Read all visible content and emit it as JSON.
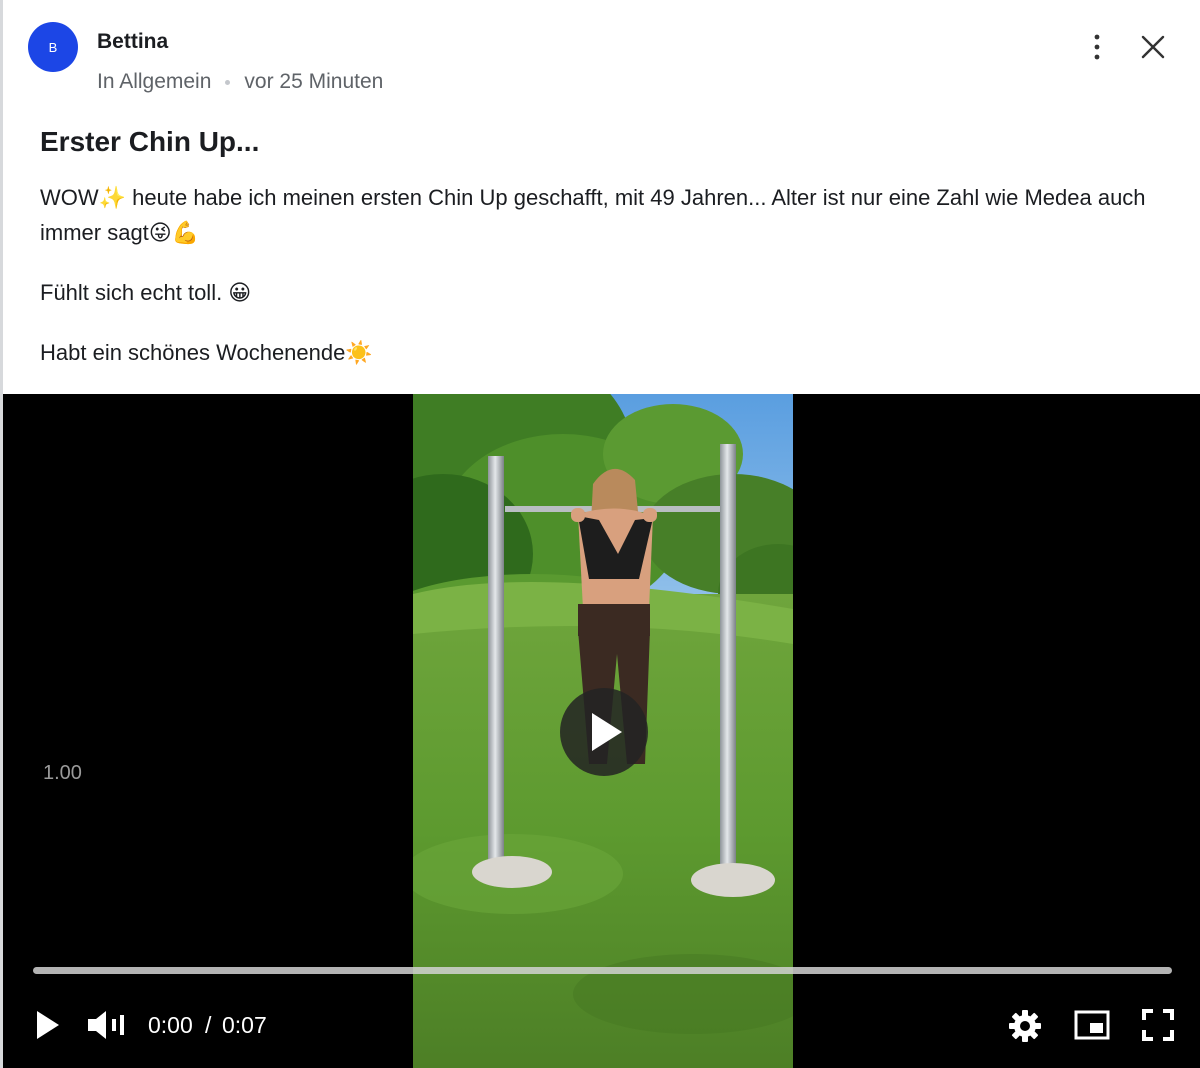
{
  "post": {
    "avatar_initial": "B",
    "author": "Bettina",
    "category": "In Allgemein",
    "time_ago": "vor 25 Minuten",
    "title": "Erster Chin Up...",
    "paragraphs": [
      "WOW✨ heute habe ich meinen ersten Chin Up geschafft, mit 49 Jahren... Alter ist nur eine Zahl wie Medea auch immer sagt😜💪",
      "Fühlt sich echt toll. 😀",
      "Habt ein schönes Wochenende☀️"
    ]
  },
  "icons": {
    "more": "more-vertical-icon",
    "close": "close-icon",
    "play": "play-icon",
    "volume": "volume-icon",
    "settings": "gear-icon",
    "pip": "picture-in-picture-icon",
    "fullscreen": "fullscreen-icon"
  },
  "video": {
    "playback_rate": "1.00",
    "current_time": "0:00",
    "separator": "/",
    "duration": "0:07",
    "progress": 0.0
  },
  "colors": {
    "avatar": "#1c46e6",
    "text": "#1b1d21",
    "muted": "#5f6368"
  }
}
